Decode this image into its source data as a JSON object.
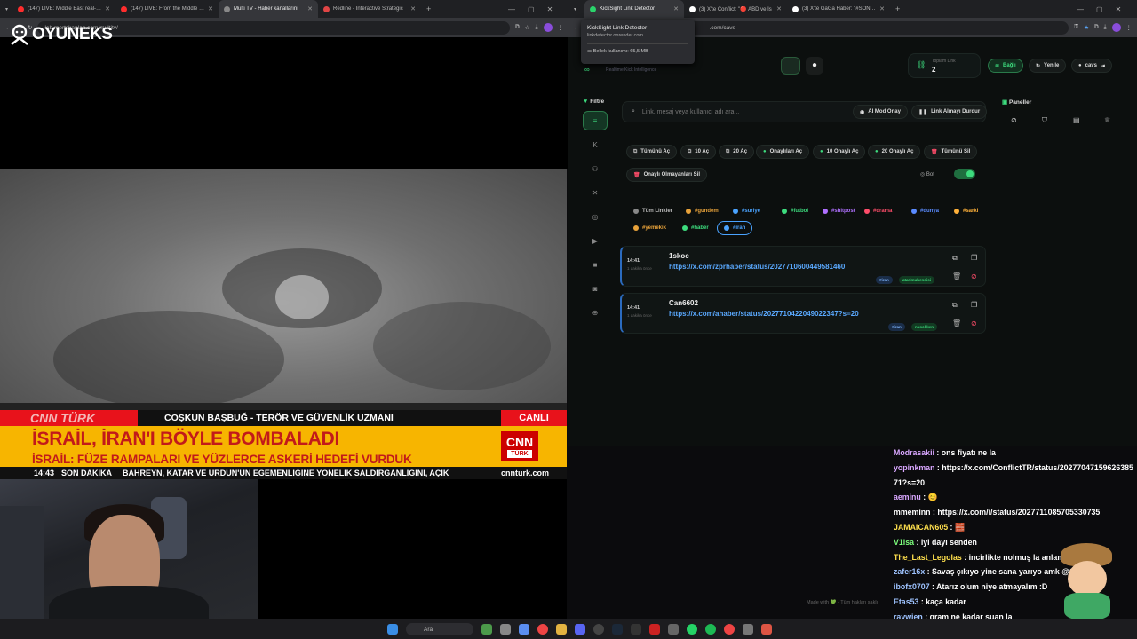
{
  "left_browser": {
    "tabs": [
      {
        "label": "(147) LIVE: Middle East real-tim",
        "color": "#ff2d2d"
      },
      {
        "label": "(147) LIVE: From the Middle Ea",
        "color": "#ff2d2d"
      },
      {
        "label": "Multi TV - Haber kanallarını",
        "color": "#888888"
      },
      {
        "label": "Redline - Interactive Strategic",
        "color": "#e04545"
      }
    ],
    "url": "lab.mertskaplan.com/multitv/"
  },
  "right_browser": {
    "tabs": [
      {
        "label": "KickSight Link Detector",
        "color": "#2bd46b"
      },
      {
        "label": "(3) X'te Conflict: \"🔴 ABD ve İs",
        "color": "#ffffff"
      },
      {
        "label": "(3) X'te GaGa Haber: \"#SONDA",
        "color": "#ffffff"
      }
    ],
    "url": ".com/cavs",
    "popup": {
      "title": "KickSight Link Detector",
      "domain": "linkdetector.onrender.com",
      "memory": "Bellek kullanımı: 65,5 MB"
    }
  },
  "overlay_logo": "OYUNEKS",
  "tv": {
    "channel": "CNN TÜRK",
    "speaker": "COŞKUN BAŞBUĞ - TERÖR VE GÜVENLİK UZMANI",
    "live": "CANLI",
    "headline": "İSRAİL, İRAN'I BÖYLE BOMBALADI",
    "subheadline": "İSRAİL: FÜZE RAMPALARI VE YÜZLERCE ASKERİ HEDEFİ VURDUK",
    "logo_top": "CNN",
    "logo_bottom": "TÜRK",
    "time": "14:43",
    "breaking": "SON DAKİKA",
    "ticker": "BAHREYN, KATAR VE ÜRDÜN'ÜN EGEMENLİĞİNE YÖNELİK SALDIRGANLIĞINI, AÇIK",
    "site": "cnnturk.com"
  },
  "app": {
    "tagline": "Realtime Kick Intelligence",
    "total_links_label": "Toplam Link",
    "total_links": "2",
    "connected": "Bağlı",
    "refresh": "Yenile",
    "user": "cavs",
    "filter_label": "Filtre",
    "panels_label": "Paneller",
    "search_placeholder": "Link, mesaj veya kullanıcı adı ara...",
    "ai_mod": "AI Mod Onay",
    "stop_links": "Link Almayı Durdur",
    "actions": [
      "Tümünü Aç",
      "10 Aç",
      "20 Aç",
      "Onaylıları Aç",
      "10 Onaylı Aç",
      "20 Onaylı Aç",
      "Tümünü Sil"
    ],
    "delete_unapproved": "Onaylı Olmayanları Sil",
    "bot": "Bot",
    "tags": [
      {
        "label": "Tüm Linkler",
        "color": "#888888"
      },
      {
        "label": "#gundem",
        "color": "#e8a23a"
      },
      {
        "label": "#suriye",
        "color": "#4aa3ff"
      },
      {
        "label": "#futbol",
        "color": "#3ddc7e"
      },
      {
        "label": "#shitpost",
        "color": "#b070ff"
      },
      {
        "label": "#drama",
        "color": "#ff4d6a"
      },
      {
        "label": "#dunya",
        "color": "#5a8bff"
      },
      {
        "label": "#sarki",
        "color": "#ffb13a"
      },
      {
        "label": "#yemekik",
        "color": "#e8a23a"
      },
      {
        "label": "#haber",
        "color": "#3ddc7e"
      },
      {
        "label": "#iran",
        "color": "#4aa3ff"
      }
    ],
    "links": [
      {
        "time": "14:41",
        "ago": "1 dakika önce",
        "user": "1skoc",
        "url": "https://x.com/zprhaber/status/2027710600449581460",
        "tag": "#iran",
        "badge": "atarimuhendisi"
      },
      {
        "time": "14:41",
        "ago": "1 dakika önce",
        "user": "Can6602",
        "url": "https://x.com/ahaber/status/2027710422049022347?s=20",
        "tag": "#iran",
        "badge": "nusokken"
      }
    ],
    "footer": "Made with 💚 - Tüm hakları saklı"
  },
  "chat": [
    {
      "user": "Modrasakii",
      "color": "#d9a7ff",
      "msg": "ons fiyatı ne la"
    },
    {
      "user": "yopinkman",
      "color": "#d9a7ff",
      "msg": "https://x.com/ConflictTR/status/2027704715962638571?s=20"
    },
    {
      "user": "aeminu",
      "color": "#d9a7ff",
      "msg": "😊"
    },
    {
      "user": "mmeminn",
      "color": "#ffffff",
      "msg": "https://x.com/i/status/2027711085705330735"
    },
    {
      "user": "JAMAICAN605",
      "color": "#ffe04d",
      "msg": "🧱"
    },
    {
      "user": "V1isa",
      "color": "#7dff7d",
      "msg": "iyi dayı senden"
    },
    {
      "user": "The_Last_Legolas",
      "color": "#ffe04d",
      "msg": "incirlikte nolmuş la anlamadım"
    },
    {
      "user": "zafer16x",
      "color": "#9ec3ff",
      "msg": "Savaş çıkıyo yine sana yarıyo amk @Cavs"
    },
    {
      "user": "ibofx0707",
      "color": "#9ec3ff",
      "msg": "Atarız olum niye atmayalım :D"
    },
    {
      "user": "Etas53",
      "color": "#9ec3ff",
      "msg": "kaça kadar"
    },
    {
      "user": "raywien",
      "color": "#9ec3ff",
      "msg": "gram ne kadar şuan la"
    }
  ],
  "taskbar": {
    "search": "Ara"
  }
}
